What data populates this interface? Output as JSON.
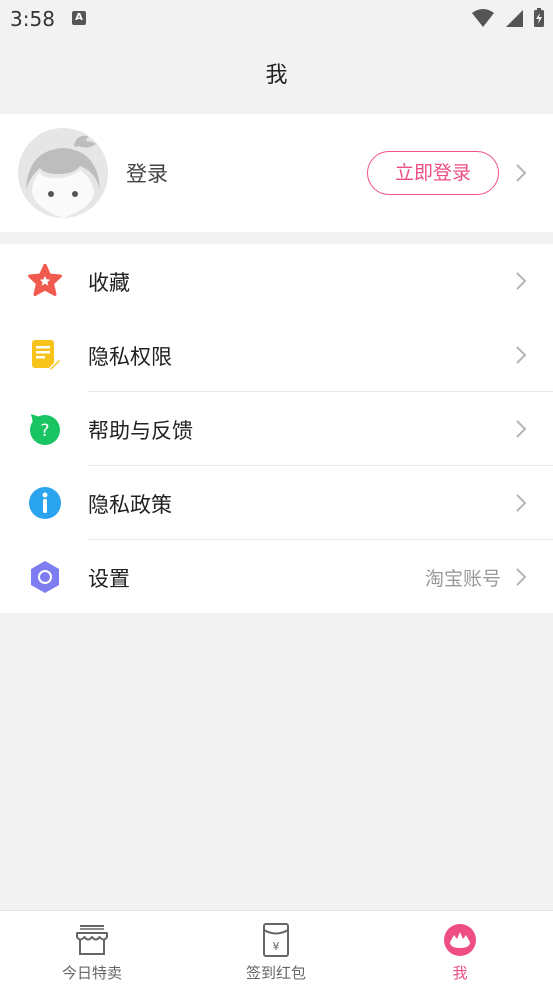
{
  "status_bar": {
    "time": "3:58",
    "notification_letter": "A"
  },
  "header": {
    "title": "我"
  },
  "profile": {
    "login_text": "登录",
    "login_button": "立即登录"
  },
  "menu": {
    "items": [
      {
        "label": "收藏",
        "icon": "star-icon",
        "right_text": ""
      },
      {
        "label": "隐私权限",
        "icon": "document-edit-icon",
        "right_text": ""
      },
      {
        "label": "帮助与反馈",
        "icon": "question-bubble-icon",
        "right_text": ""
      },
      {
        "label": "隐私政策",
        "icon": "info-icon",
        "right_text": ""
      },
      {
        "label": "设置",
        "icon": "hexagon-settings-icon",
        "right_text": "淘宝账号"
      }
    ]
  },
  "bottom_nav": {
    "items": [
      {
        "label": "今日特卖",
        "icon": "shop-icon",
        "active": false
      },
      {
        "label": "签到红包",
        "icon": "red-envelope-icon",
        "active": false
      },
      {
        "label": "我",
        "icon": "profile-icon",
        "active": true
      }
    ]
  },
  "colors": {
    "accent": "#ee4d86",
    "background": "#f2f2f2",
    "star": "#f05a4f",
    "document": "#f7c21a",
    "question": "#19c463",
    "info": "#2aa4ef",
    "hexagon": "#7d7cf0"
  }
}
